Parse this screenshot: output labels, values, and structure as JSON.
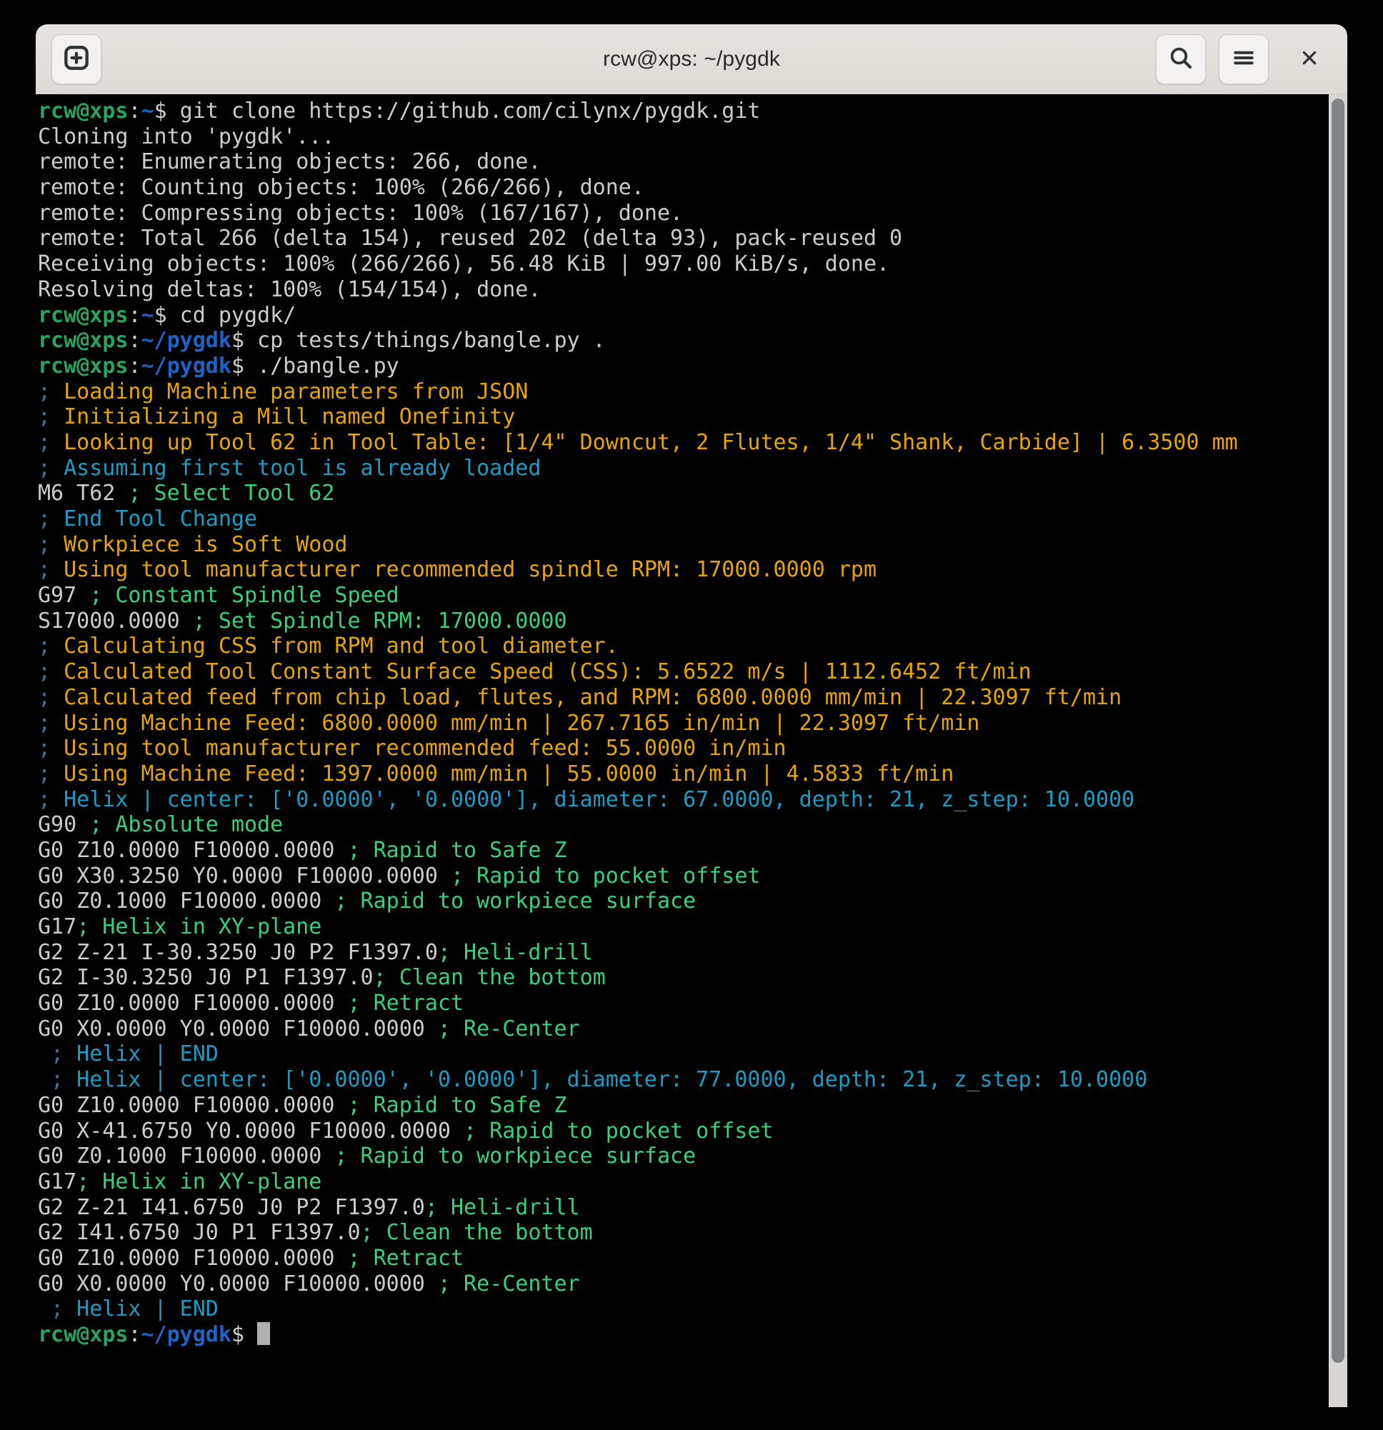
{
  "window": {
    "title": "rcw@xps: ~/pygdk",
    "new_tab_label": "New Tab",
    "search_label": "Search",
    "menu_label": "Main Menu",
    "close_label": "Close"
  },
  "icons": {
    "new_tab": "new-tab-icon",
    "search": "search-icon",
    "menu": "hamburger-menu-icon",
    "close": "close-icon"
  },
  "colors": {
    "background": "#000000",
    "foreground": "#cccccc",
    "titlebar": "#e0dcd8",
    "prompt_user": "#2aa35c",
    "prompt_path": "#1d64c9",
    "comment_yellow": "#e5a50a",
    "comment_cyan": "#1c9cc4",
    "comment_green": "#3ad07a",
    "semicolon_blue": "#3f6f9a",
    "scrollbar_thumb": "#7f8486",
    "cursor": "#b0b0b0"
  },
  "prompt": {
    "user_host": "rcw@xps",
    "colon": ":",
    "path_home": "~",
    "path_pygdk": "~/pygdk",
    "sigil": "$"
  },
  "terminal": {
    "lines": [
      {
        "type": "prompt",
        "path": "~",
        "command": " git clone https://github.com/cilynx/pygdk.git"
      },
      {
        "type": "plain",
        "text": "Cloning into 'pygdk'..."
      },
      {
        "type": "plain",
        "text": "remote: Enumerating objects: 266, done."
      },
      {
        "type": "plain",
        "text": "remote: Counting objects: 100% (266/266), done."
      },
      {
        "type": "plain",
        "text": "remote: Compressing objects: 100% (167/167), done."
      },
      {
        "type": "plain",
        "text": "remote: Total 266 (delta 154), reused 202 (delta 93), pack-reused 0"
      },
      {
        "type": "plain",
        "text": "Receiving objects: 100% (266/266), 56.48 KiB | 997.00 KiB/s, done."
      },
      {
        "type": "plain",
        "text": "Resolving deltas: 100% (154/154), done."
      },
      {
        "type": "prompt",
        "path": "~",
        "command": " cd pygdk/"
      },
      {
        "type": "prompt",
        "path": "~/pygdk",
        "command": " cp tests/things/bangle.py ."
      },
      {
        "type": "prompt",
        "path": "~/pygdk",
        "command": " ./bangle.py"
      },
      {
        "type": "semi",
        "semi": ";",
        "body": " Loading Machine parameters from JSON",
        "color": "yellow"
      },
      {
        "type": "semi",
        "semi": ";",
        "body": " Initializing a Mill named Onefinity",
        "color": "yellow"
      },
      {
        "type": "semi",
        "semi": ";",
        "body": " Looking up Tool 62 in Tool Table: [1/4\" Downcut, 2 Flutes, 1/4\" Shank, Carbide] | 6.3500 mm",
        "color": "yellow"
      },
      {
        "type": "semi",
        "semi": ";",
        "body": " Assuming first tool is already loaded",
        "color": "cyan"
      },
      {
        "type": "code",
        "code": "M6 T62 ",
        "comment": "; Select Tool 62",
        "color": "green"
      },
      {
        "type": "semi",
        "semi": ";",
        "body": " End Tool Change",
        "color": "cyan"
      },
      {
        "type": "semi",
        "semi": ";",
        "body": " Workpiece is Soft Wood",
        "color": "yellow"
      },
      {
        "type": "semi",
        "semi": ";",
        "body": " Using tool manufacturer recommended spindle RPM: 17000.0000 rpm",
        "color": "yellow"
      },
      {
        "type": "code",
        "code": "G97 ",
        "comment": "; Constant Spindle Speed",
        "color": "green"
      },
      {
        "type": "code",
        "code": "S17000.0000 ",
        "comment": "; Set Spindle RPM: 17000.0000",
        "color": "green"
      },
      {
        "type": "semi",
        "semi": ";",
        "body": " Calculating CSS from RPM and tool diameter.",
        "color": "yellow"
      },
      {
        "type": "semi",
        "semi": ";",
        "body": " Calculated Tool Constant Surface Speed (CSS): 5.6522 m/s | 1112.6452 ft/min",
        "color": "yellow"
      },
      {
        "type": "semi",
        "semi": ";",
        "body": " Calculated feed from chip load, flutes, and RPM: 6800.0000 mm/min | 22.3097 ft/min",
        "color": "yellow"
      },
      {
        "type": "semi",
        "semi": ";",
        "body": " Using Machine Feed: 6800.0000 mm/min | 267.7165 in/min | 22.3097 ft/min",
        "color": "yellow"
      },
      {
        "type": "semi",
        "semi": ";",
        "body": " Using tool manufacturer recommended feed: 55.0000 in/min",
        "color": "yellow"
      },
      {
        "type": "semi",
        "semi": ";",
        "body": " Using Machine Feed: 1397.0000 mm/min | 55.0000 in/min | 4.5833 ft/min",
        "color": "yellow"
      },
      {
        "type": "semi",
        "semi": ";",
        "body": " Helix | center: ['0.0000', '0.0000'], diameter: 67.0000, depth: 21, z_step: 10.0000",
        "color": "cyan"
      },
      {
        "type": "code",
        "code": "G90 ",
        "comment": "; Absolute mode",
        "color": "green"
      },
      {
        "type": "code",
        "code": "G0 Z10.0000 F10000.0000 ",
        "comment": "; Rapid to Safe Z",
        "color": "green"
      },
      {
        "type": "code",
        "code": "G0 X30.3250 Y0.0000 F10000.0000 ",
        "comment": "; Rapid to pocket offset",
        "color": "green"
      },
      {
        "type": "code",
        "code": "G0 Z0.1000 F10000.0000 ",
        "comment": "; Rapid to workpiece surface",
        "color": "green"
      },
      {
        "type": "code",
        "code": "G17",
        "comment": "; Helix in XY-plane",
        "color": "green"
      },
      {
        "type": "code",
        "code": "G2 Z-21 I-30.3250 J0 P2 F1397.0",
        "comment": "; Heli-drill",
        "color": "green"
      },
      {
        "type": "code",
        "code": "G2 I-30.3250 J0 P1 F1397.0",
        "comment": "; Clean the bottom",
        "color": "green"
      },
      {
        "type": "code",
        "code": "G0 Z10.0000 F10000.0000 ",
        "comment": "; Retract",
        "color": "green"
      },
      {
        "type": "code",
        "code": "G0 X0.0000 Y0.0000 F10000.0000 ",
        "comment": "; Re-Center",
        "color": "green"
      },
      {
        "type": "semi",
        "semi": " ;",
        "body": " Helix | END",
        "color": "cyan"
      },
      {
        "type": "semi",
        "semi": " ;",
        "body": " Helix | center: ['0.0000', '0.0000'], diameter: 77.0000, depth: 21, z_step: 10.0000",
        "color": "cyan"
      },
      {
        "type": "code",
        "code": "G0 Z10.0000 F10000.0000 ",
        "comment": "; Rapid to Safe Z",
        "color": "green"
      },
      {
        "type": "code",
        "code": "G0 X-41.6750 Y0.0000 F10000.0000 ",
        "comment": "; Rapid to pocket offset",
        "color": "green"
      },
      {
        "type": "code",
        "code": "G0 Z0.1000 F10000.0000 ",
        "comment": "; Rapid to workpiece surface",
        "color": "green"
      },
      {
        "type": "code",
        "code": "G17",
        "comment": "; Helix in XY-plane",
        "color": "green"
      },
      {
        "type": "code",
        "code": "G2 Z-21 I41.6750 J0 P2 F1397.0",
        "comment": "; Heli-drill",
        "color": "green"
      },
      {
        "type": "code",
        "code": "G2 I41.6750 J0 P1 F1397.0",
        "comment": "; Clean the bottom",
        "color": "green"
      },
      {
        "type": "code",
        "code": "G0 Z10.0000 F10000.0000 ",
        "comment": "; Retract",
        "color": "green"
      },
      {
        "type": "code",
        "code": "G0 X0.0000 Y0.0000 F10000.0000 ",
        "comment": "; Re-Center",
        "color": "green"
      },
      {
        "type": "semi",
        "semi": " ;",
        "body": " Helix | END",
        "color": "cyan"
      },
      {
        "type": "prompt_cursor",
        "path": "~/pygdk",
        "command": " "
      }
    ]
  }
}
